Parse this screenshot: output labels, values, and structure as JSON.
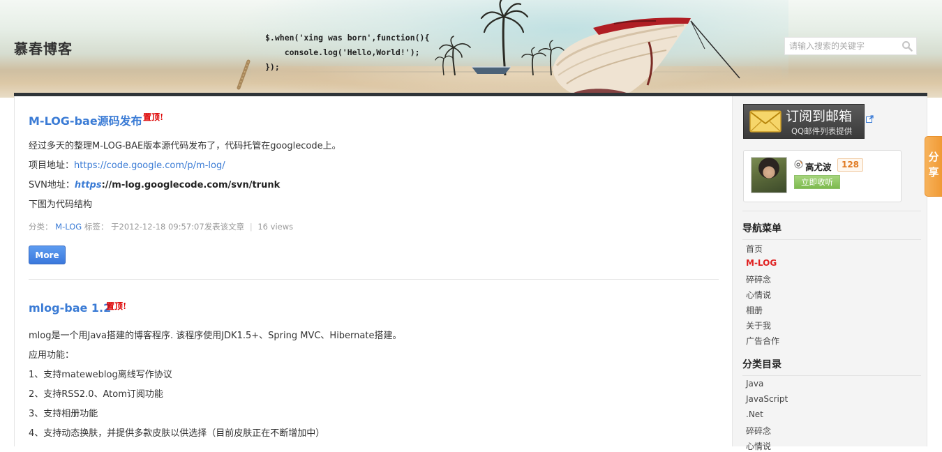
{
  "header": {
    "site_title": "慕春博客",
    "code_lines": [
      "$.when('xing was born',function(){",
      "    console.log('Hello,World!');",
      "});"
    ],
    "search": {
      "placeholder": "请输入搜索的关键字"
    }
  },
  "posts": [
    {
      "title": "M-LOG-bae源码发布",
      "pinned_label": "置顶!",
      "body": {
        "intro": "经过多天的整理M-LOG-BAE版本源代码发布了，代码托管在googlecode上。",
        "project_label": "项目地址：",
        "project_url": "https://code.google.com/p/m-log/",
        "svn_label": "SVN地址：",
        "svn_scheme": "https",
        "svn_rest": "://m-log.googlecode.com/svn/trunk",
        "structure_note": "下图为代码结构"
      },
      "meta": {
        "category_label": "分类：",
        "category": "M-LOG",
        "tags_label": "标签：",
        "published": "于2012-12-18 09:57:07发表该文章",
        "views": "16 views"
      },
      "more_label": "More"
    },
    {
      "title": "mlog-bae 1.2",
      "pinned_label": "置顶!",
      "body": {
        "intro": "mlog是一个用Java搭建的博客程序. 该程序使用JDK1.5+、Spring MVC、Hibernate搭建。",
        "features_label": "应用功能：",
        "features": [
          "1、支持mateweblog离线写作协议",
          "2、支持RSS2.0、Atom订阅功能",
          "3、支持相册功能",
          "4、支持动态换肤，并提供多款皮肤以供选择（目前皮肤正在不断增加中）"
        ]
      }
    }
  ],
  "sidebar": {
    "subscribe": {
      "title": "订阅到邮箱",
      "subtitle": "QQ邮件列表提供"
    },
    "weibo": {
      "name": "高尤波",
      "fans": "128",
      "follow_label": "立即收听"
    },
    "nav_heading": "导航菜单",
    "nav_items": [
      {
        "label": "首页"
      },
      {
        "label": "M-LOG",
        "active": true
      },
      {
        "label": "碎碎念"
      },
      {
        "label": "心情说"
      },
      {
        "label": "相册"
      },
      {
        "label": "关于我"
      },
      {
        "label": "广告合作"
      }
    ],
    "category_heading": "分类目录",
    "categories": [
      "Java",
      "JavaScript",
      ".Net",
      "碎碎念",
      "心情说"
    ]
  },
  "share_tab": {
    "line1": "分",
    "line2": "享"
  },
  "colors": {
    "link": "#3a7bd5",
    "pinned": "#dd0000",
    "active_nav": "#e02020",
    "header_bar": "#2f3438",
    "share_tab": "#f0a040",
    "fans_badge": "#e07a22"
  }
}
